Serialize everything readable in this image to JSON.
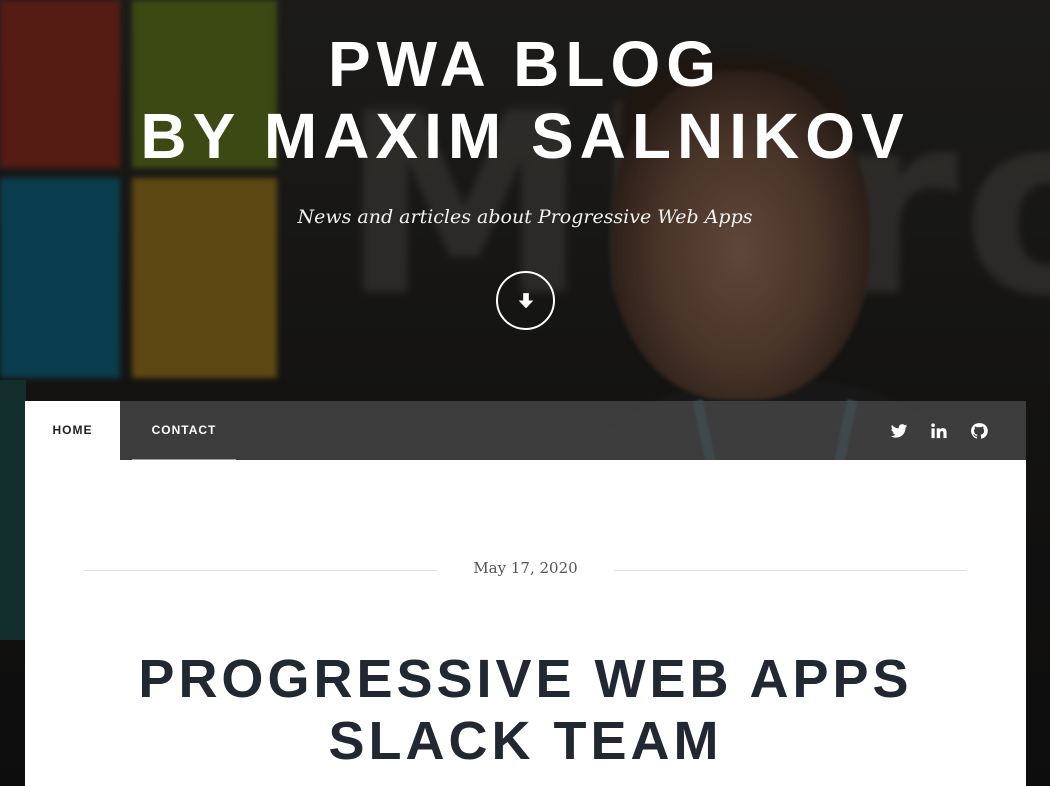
{
  "header": {
    "title_line1": "PWA BLOG",
    "title_line2": "BY MAXIM SALNIKOV",
    "tagline": "News and articles about Progressive Web Apps",
    "scroll_icon": "arrow-down-icon"
  },
  "nav": {
    "items": [
      {
        "label": "HOME",
        "active": true
      },
      {
        "label": "CONTACT",
        "active": false
      }
    ],
    "social": [
      {
        "icon": "twitter-icon"
      },
      {
        "icon": "linkedin-icon"
      },
      {
        "icon": "github-icon"
      }
    ]
  },
  "post": {
    "date": "May 17, 2020",
    "title_line1": "PROGRESSIVE WEB APPS",
    "title_line2": "SLACK TEAM"
  },
  "colors": {
    "title_dark": "#222831",
    "nav_bg": "#464646",
    "page_bg": "#ffffff"
  }
}
